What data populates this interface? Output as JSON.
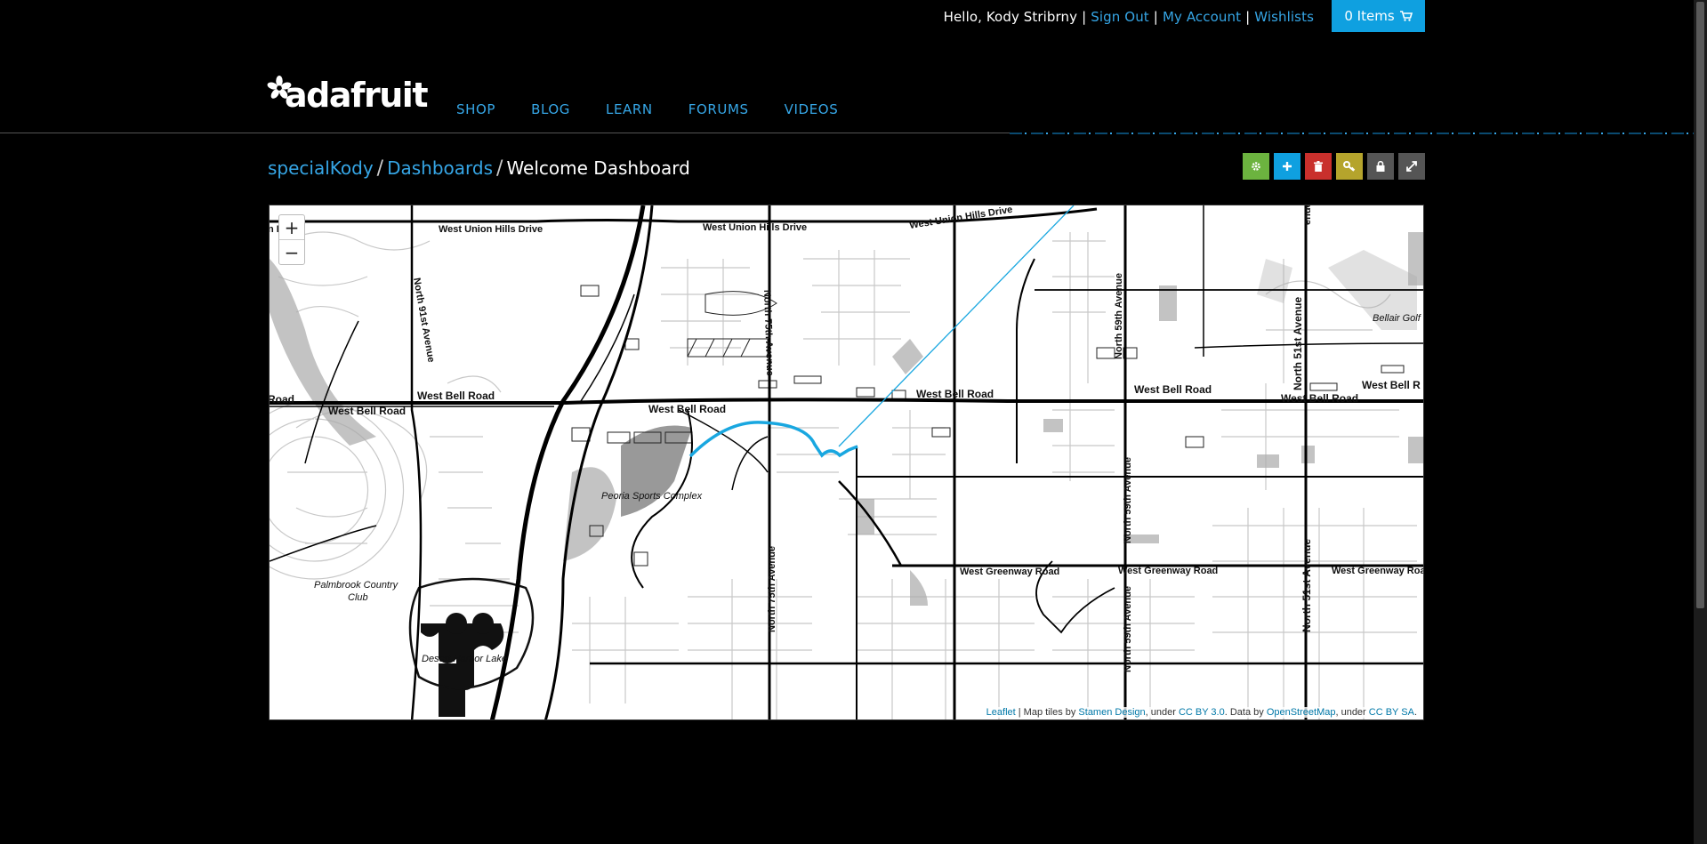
{
  "topbar": {
    "greeting": "Hello, Kody Stribrny",
    "sign_out": "Sign Out",
    "my_account": "My Account",
    "wishlists": "Wishlists",
    "cart_label": "0 Items",
    "cart_icon": "cart-icon"
  },
  "header": {
    "logo_text": "adafruit",
    "nav": [
      "SHOP",
      "BLOG",
      "LEARN",
      "FORUMS",
      "VIDEOS"
    ]
  },
  "breadcrumb": {
    "user": "specialKody",
    "section": "Dashboards",
    "current": "Welcome Dashboard"
  },
  "toolbar": [
    {
      "icon": "gear-icon",
      "color": "#6cb33f",
      "glyph": "⚙"
    },
    {
      "icon": "plus-icon",
      "color": "#0fa0e0",
      "glyph": "+"
    },
    {
      "icon": "trash-icon",
      "color": "#c9302c",
      "glyph": "🗑"
    },
    {
      "icon": "key-icon",
      "color": "#b5a42c",
      "glyph": "⚿"
    },
    {
      "icon": "lock-icon",
      "color": "#555555",
      "glyph": "🔒"
    },
    {
      "icon": "expand-icon",
      "color": "#555555",
      "glyph": "⤢"
    }
  ],
  "map": {
    "zoom_in": "+",
    "zoom_out": "−",
    "labels": {
      "road_left": "Road",
      "drive_left": "n Drive",
      "west_union_hills_1": "West Union Hills Drive",
      "west_union_hills_2": "West Union Hills Drive",
      "west_union_hills_3": "West Union Hills Drive",
      "west_bell_1": "West Bell Road",
      "west_bell_2": "West Bell Road",
      "west_bell_3": "West Bell Road",
      "west_bell_4": "West Bell Road",
      "west_bell_5": "West Bell Road",
      "west_bell_6": "West Bell Road",
      "west_bell_7": "West Bell R",
      "n91": "North 91st Avenue",
      "n75_top": "North 75th Avenue",
      "n75_bottom": "North 75th Avenue",
      "n59_top": "North 59th Avenue",
      "n59_mid": "North 59th Avenue",
      "n59_bottom": "North 59th Avenue",
      "n51_top": "North 51st Avenue",
      "n51_bottom": "North 51st Avenue",
      "greenway_1": "West Greenway Road",
      "greenway_2": "West Greenway Road",
      "greenway_3": "West Greenway Roa",
      "peoria": "Peoria Sports Complex",
      "palmbrook_1": "Palmbrook Country",
      "palmbrook_2": "Club",
      "desert_harbor": "Desert Harbor Lake",
      "bellair": "Bellair Golf C",
      "top_right_cut": "enue"
    },
    "track_color": "#19a7e0"
  },
  "attribution": {
    "leaflet": "Leaflet",
    "sep1": " | Map tiles by ",
    "stamen": "Stamen Design",
    "sep2": ", under ",
    "ccby": "CC BY 3.0",
    "sep3": ". Data by ",
    "osm": "OpenStreetMap",
    "sep4": ", under ",
    "ccbysa": "CC BY SA",
    "end": "."
  }
}
